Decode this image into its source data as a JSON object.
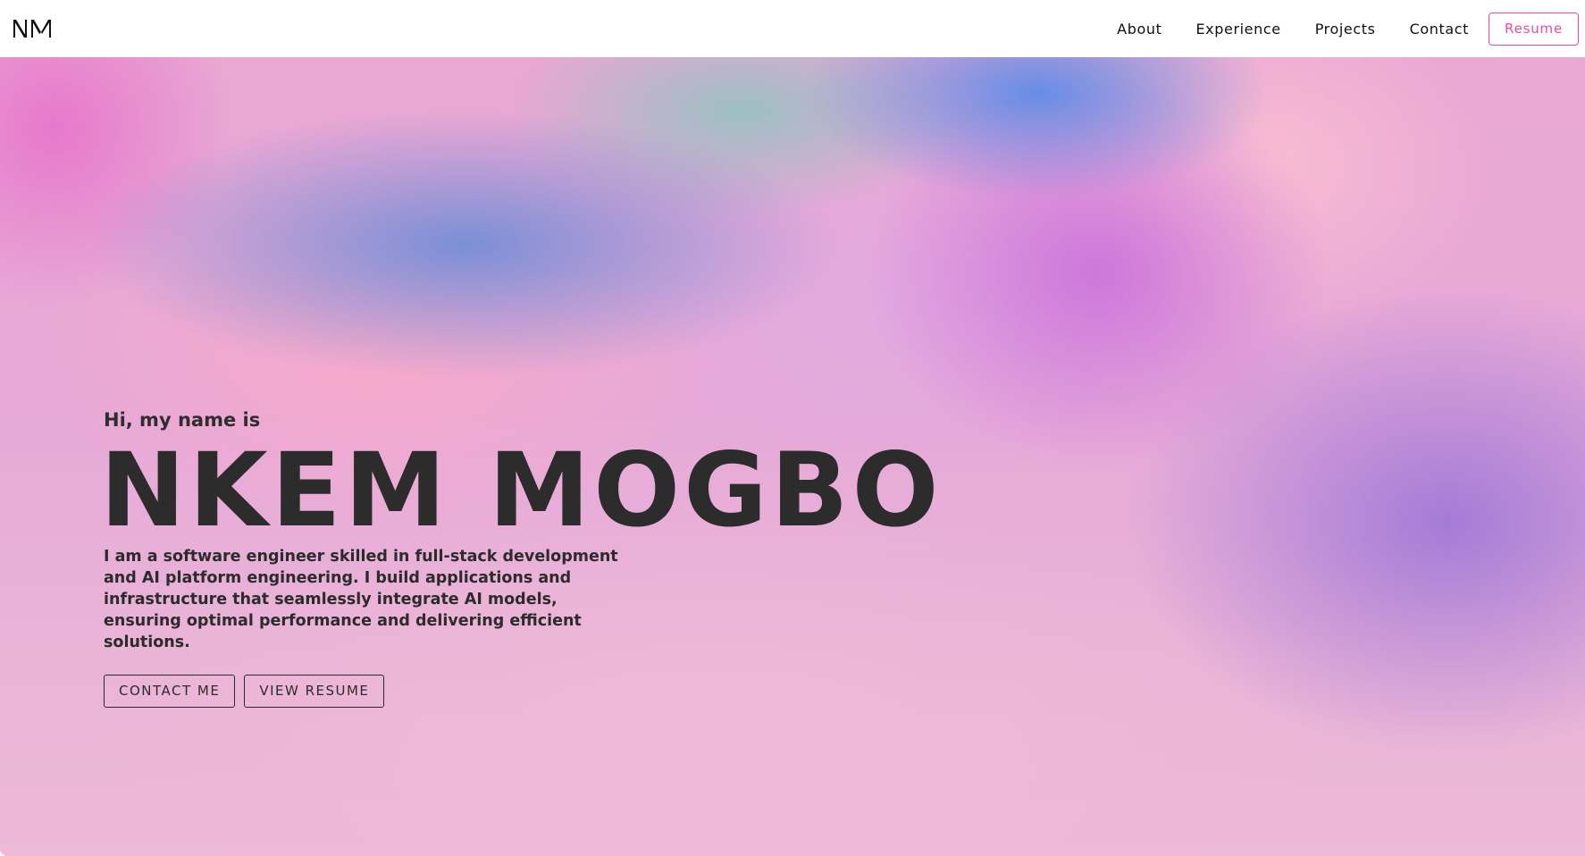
{
  "header": {
    "logo": "NM",
    "nav_items": [
      {
        "label": "About"
      },
      {
        "label": "Experience"
      },
      {
        "label": "Projects"
      },
      {
        "label": "Contact"
      }
    ],
    "resume_label": "Resume"
  },
  "hero": {
    "greeting": "Hi, my name is",
    "name": "NKEM MOGBO",
    "bio": "I am a software engineer skilled in full-stack development and AI platform engineering. I build applications and infrastructure that seamlessly integrate AI models, ensuring optimal performance and delivering efficient solutions.",
    "contact_button": "CONTACT ME",
    "resume_button": "VIEW RESUME"
  },
  "colors": {
    "accent": "#ea4aa0",
    "text": "#2c2c2c",
    "background_top": "#e9a7d3",
    "background_bottom": "#ecb9d6"
  },
  "icons": {
    "logo": "nm-monogram-logo"
  }
}
